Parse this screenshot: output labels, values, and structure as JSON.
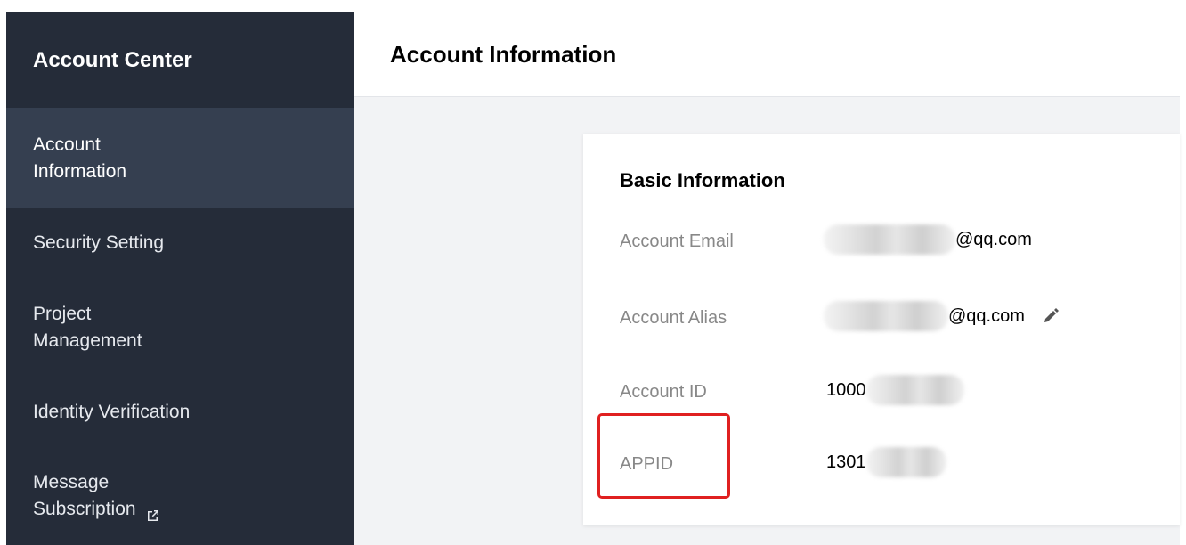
{
  "sidebar": {
    "title": "Account Center",
    "items": [
      {
        "label_line1": "Account",
        "label_line2": "Information"
      },
      {
        "label": "Security Setting"
      },
      {
        "label_line1": "Project",
        "label_line2": "Management"
      },
      {
        "label": "Identity Verification"
      },
      {
        "label_line1": "Message",
        "label_line2": "Subscription"
      }
    ]
  },
  "main": {
    "title": "Account Information",
    "card": {
      "title": "Basic Information",
      "fields": [
        {
          "label": "Account Email",
          "value_suffix": "@qq.com"
        },
        {
          "label": "Account Alias",
          "value_suffix": "@qq.com"
        },
        {
          "label": "Account ID",
          "value_prefix": "1000"
        },
        {
          "label": "APPID",
          "value_prefix": "1301"
        }
      ]
    }
  },
  "colors": {
    "sidebar_bg": "#252c39",
    "sidebar_active": "#353f50",
    "highlight": "#e02020"
  },
  "icons": {
    "edit": "pencil-icon",
    "external": "external-link-icon"
  }
}
